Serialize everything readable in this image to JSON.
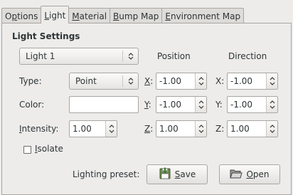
{
  "tabs": [
    {
      "label": "Options",
      "mnemonic": "p",
      "active": false
    },
    {
      "label": "Light",
      "mnemonic": "L",
      "active": true
    },
    {
      "label": "Material",
      "mnemonic": "M",
      "active": false
    },
    {
      "label": "Bump Map",
      "mnemonic": "B",
      "active": false
    },
    {
      "label": "Environment Map",
      "mnemonic": "E",
      "active": false
    }
  ],
  "light_settings": {
    "heading": "Light Settings",
    "light_select": "Light 1",
    "type_label": "Type:",
    "type_value": "Point",
    "color_label": "Color:",
    "color_value": "#ffffff",
    "intensity_label": "Intensity:",
    "intensity_value": "1.00",
    "isolate_label": "Isolate",
    "isolate_checked": false
  },
  "position": {
    "heading": "Position",
    "x_label": "X:",
    "x_value": "-1.00",
    "y_label": "Y:",
    "y_value": "-1.00",
    "z_label": "Z:",
    "z_value": "1.00"
  },
  "direction": {
    "heading": "Direction",
    "x_label": "X:",
    "x_value": "-1.00",
    "y_label": "Y:",
    "y_value": "-1.00",
    "z_label": "Z:",
    "z_value": "1.00"
  },
  "preset": {
    "label": "Lighting preset:",
    "save_label": "Save",
    "open_label": "Open"
  }
}
